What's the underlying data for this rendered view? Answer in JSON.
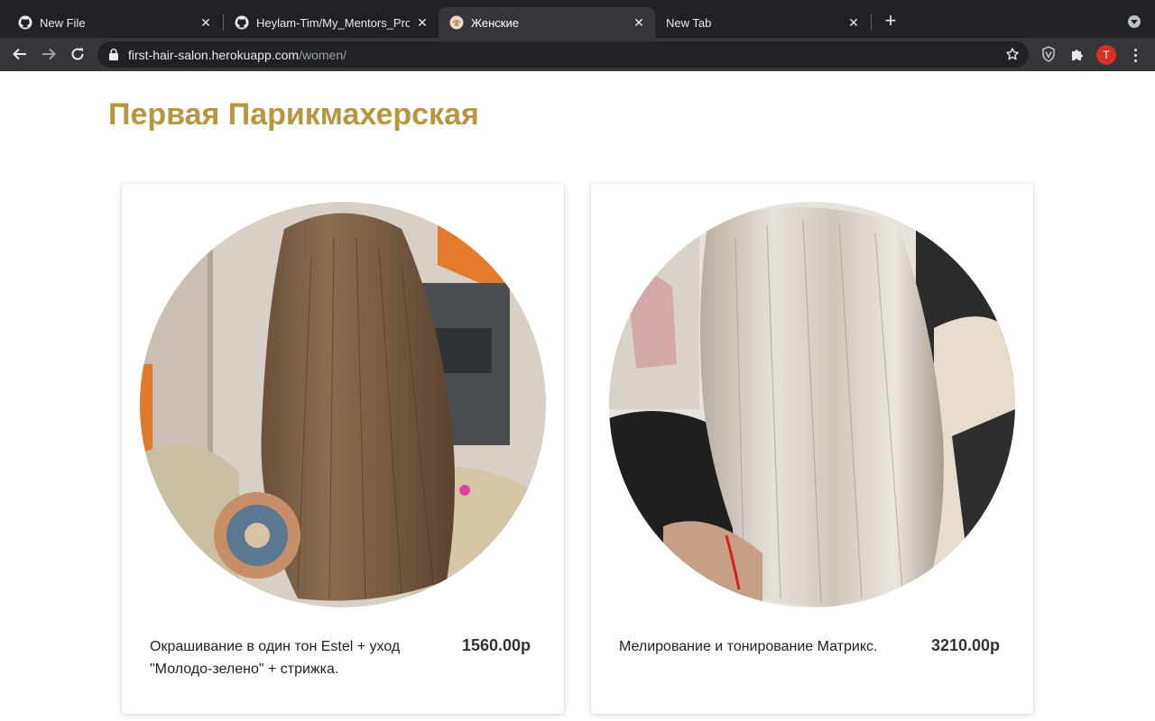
{
  "browser": {
    "tabs": [
      {
        "title": "New File",
        "icon": "github-icon"
      },
      {
        "title": "Heylam-Tim/My_Mentors_Proje",
        "icon": "github-icon"
      },
      {
        "title": "Женские",
        "icon": "salon-favicon",
        "active": true
      },
      {
        "title": "New Tab",
        "icon": "none"
      }
    ],
    "url_host": "first-hair-salon.herokuapp.com",
    "url_path": "/women/",
    "profile_initial": "T"
  },
  "page": {
    "site_title": "Первая Парикмахерская",
    "services": [
      {
        "description": "Окрашивание в один тон Estel + уход \"Молодо-зелено\" + стрижка.",
        "price": "1560.00р",
        "photo": "brown-straight-hair-photo"
      },
      {
        "description": "Мелирование и тонирование Матрикс.",
        "price": "3210.00р",
        "photo": "blonde-highlighted-hair-photo"
      }
    ]
  },
  "colors": {
    "title_gold": "#b8963f",
    "chrome_dark": "#202124",
    "chrome_toolbar": "#35363a"
  }
}
